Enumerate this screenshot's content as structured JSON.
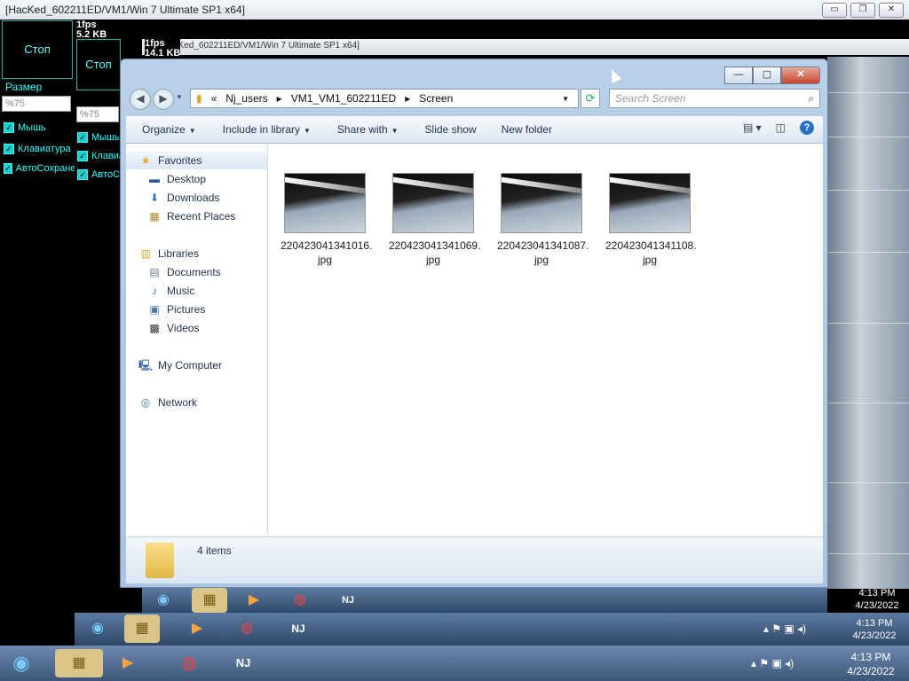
{
  "outer_window": {
    "title": "[HacKed_602211ED/VM1/Win 7 Ultimate SP1 x64]",
    "min": "▭",
    "max": "❐",
    "close": "✕"
  },
  "nested_window": {
    "title": "[HacKed_602211ED/VM1/Win 7 Ultimate SP1 x64]"
  },
  "panel1": {
    "fps": "1fps",
    "size_kb": "5.2 KB",
    "stop_label": "Стоп",
    "size_label": "Размер",
    "size_value": "%75",
    "checks": [
      "Мышь",
      "Клавиатура",
      "АвтоСохранение"
    ]
  },
  "panel2": {
    "fps": "1fps",
    "size_kb": "14.1 KB",
    "stop_label": "Стоп",
    "size_value": "%75",
    "checks": [
      "Мышь",
      "Клавиатура",
      "АвтоСо"
    ]
  },
  "explorer": {
    "breadcrumb": [
      "Nj_users",
      "VM1_VM1_602211ED",
      "Screen"
    ],
    "search_placeholder": "Search Screen",
    "toolbar": [
      "Organize",
      "Include in library",
      "Share with",
      "Slide show",
      "New folder"
    ],
    "nav": {
      "favorites": "Favorites",
      "fav_items": [
        "Desktop",
        "Downloads",
        "Recent Places"
      ],
      "libraries": "Libraries",
      "lib_items": [
        "Documents",
        "Music",
        "Pictures",
        "Videos"
      ],
      "computer": "My Computer",
      "network": "Network"
    },
    "files": [
      {
        "name1": "220423041341016.",
        "name2": "jpg"
      },
      {
        "name1": "220423041341069.",
        "name2": "jpg"
      },
      {
        "name1": "220423041341087.",
        "name2": "jpg"
      },
      {
        "name1": "220423041341108.",
        "name2": "jpg"
      }
    ],
    "status": "4 items"
  },
  "clocks": [
    {
      "time": "4:13 PM",
      "date": "4/23/2022"
    },
    {
      "time": "4:13 PM",
      "date": "4/23/2022"
    },
    {
      "time": "4:13 PM",
      "date": "4/23/2022"
    }
  ],
  "icons": {
    "start": "start-orb-icon",
    "explorer": "folder-icon",
    "media": "media-player-icon",
    "chrome": "chrome-icon",
    "njrat": "njrat-icon"
  },
  "labels": {
    "nj": "NJ",
    "help": "?"
  }
}
